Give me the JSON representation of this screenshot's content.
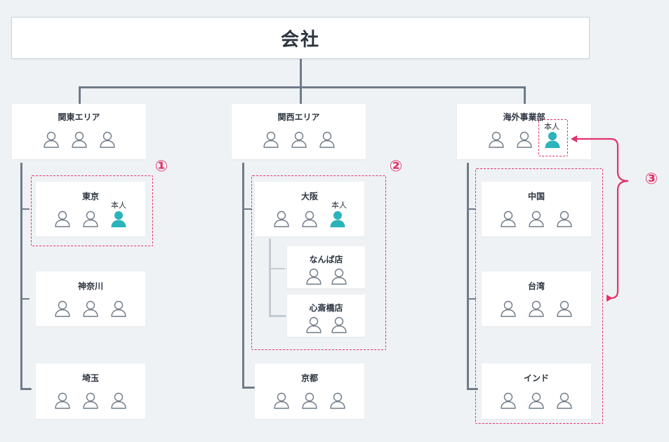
{
  "company": "会社",
  "self_label": "本人",
  "accent_color": "#e2336b",
  "self_color": "#2bb3bc",
  "regions": [
    {
      "name": "関東エリア"
    },
    {
      "name": "関西エリア"
    },
    {
      "name": "海外事業部"
    }
  ],
  "kanto": {
    "tokyo": "東京",
    "kanagawa": "神奈川",
    "saitama": "埼玉"
  },
  "kansai": {
    "osaka": "大阪",
    "namba": "なんば店",
    "shinsaibashi": "心斎橋店",
    "kyoto": "京都"
  },
  "overseas": {
    "china": "中国",
    "taiwan": "台湾",
    "india": "インド"
  },
  "markers": {
    "one": "①",
    "two": "②",
    "three": "③"
  }
}
